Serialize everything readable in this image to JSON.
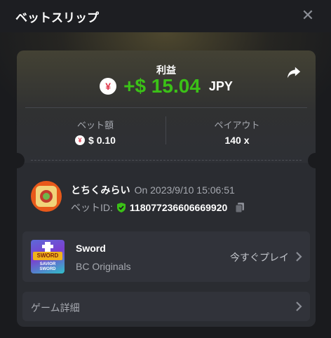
{
  "header": {
    "title": "ベットスリップ",
    "close_icon": "close-icon"
  },
  "profit": {
    "label": "利益",
    "currency_icon": "yen-icon",
    "currency_symbol": "¥",
    "amount": "+$ 15.04",
    "currency": "JPY",
    "share_icon": "share-icon"
  },
  "stats": {
    "bet_label": "ベット額",
    "bet_value": "$ 0.10",
    "payout_label": "ペイアウト",
    "payout_value": "140 x"
  },
  "bet": {
    "user_name": "とちくみらい",
    "time": "On 2023/9/10 15:06:51",
    "bet_id_label": "ベットID:",
    "bet_id": "118077236606669920",
    "verified_icon": "shield-check-icon",
    "copy_icon": "copy-icon"
  },
  "game": {
    "name": "Sword",
    "provider": "BC Originals",
    "play_label": "今すぐプレイ",
    "thumb_title": "SWORD",
    "thumb_subtitle": "SAVIOR SWORD"
  },
  "details": {
    "label": "ゲーム詳細"
  },
  "colors": {
    "profit_green": "#3bc117",
    "accent_orange": "#e8591a",
    "yen_red": "#e0364a"
  }
}
